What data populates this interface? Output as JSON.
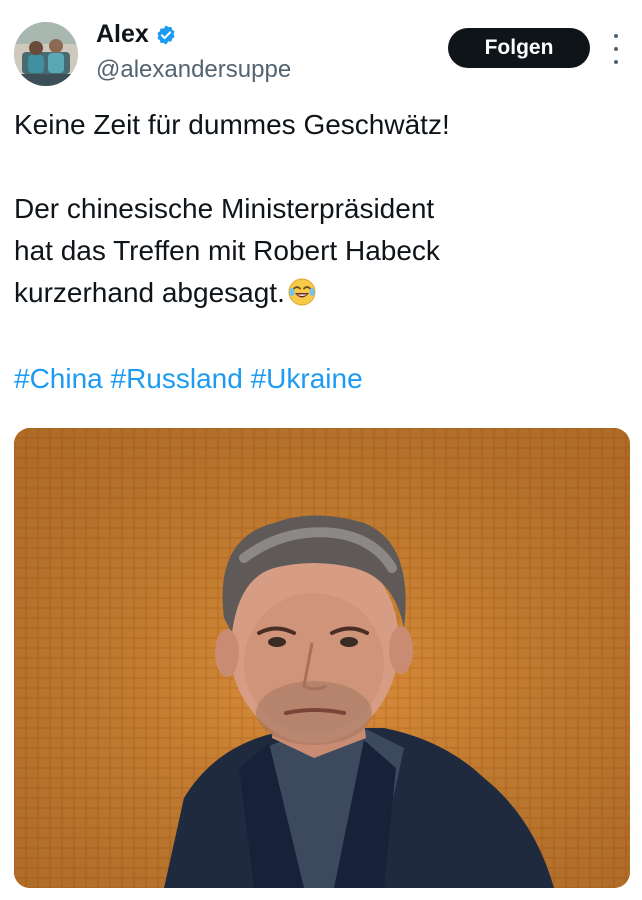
{
  "author": {
    "name": "Alex",
    "handle": "@alexandersuppe",
    "verified": true,
    "avatar_icon": "avatar-photo"
  },
  "follow_button": {
    "label": "Folgen"
  },
  "more_icon": "more-options-icon",
  "tweet": {
    "line1": "Keine Zeit für dummes Geschwätz!",
    "line2": "Der chinesische Ministerpräsident",
    "line3": "hat das Treffen mit Robert Habeck",
    "line4": "kurzerhand abgesagt.",
    "emoji": "face-with-tears-of-joy-icon",
    "hashtags": [
      "#China",
      "#Russland",
      "#Ukraine"
    ]
  },
  "image": {
    "description_icon": "photo-of-man-in-dark-suit-orange-background"
  },
  "colors": {
    "text": "#0f1419",
    "secondary": "#536471",
    "link": "#1d9bf0",
    "verified": "#1d9bf0",
    "button_bg": "#0f1419",
    "image_bg": "#d9822b"
  }
}
